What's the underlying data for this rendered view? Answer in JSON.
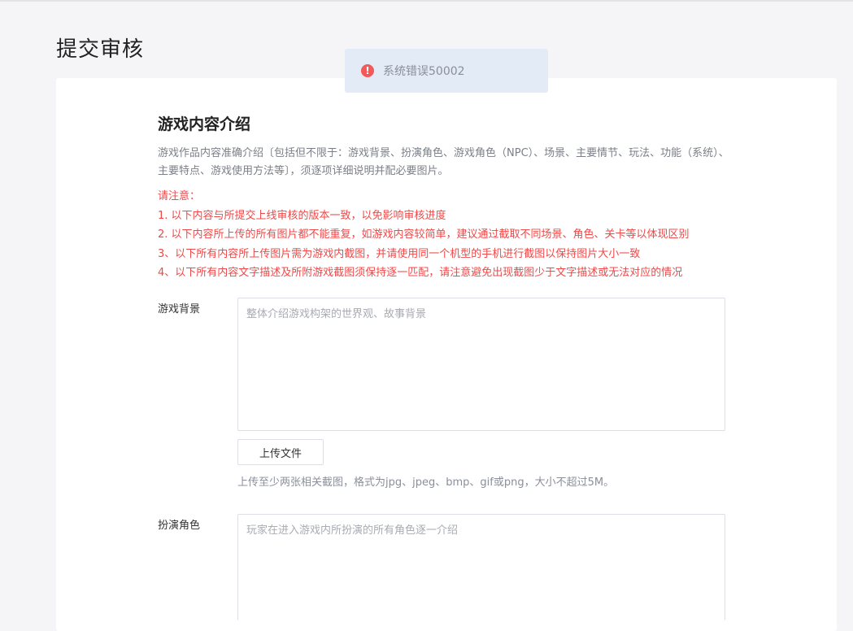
{
  "page": {
    "title": "提交审核"
  },
  "toast": {
    "icon": "error-icon",
    "message": "系统错误50002"
  },
  "intro": {
    "title": "游戏内容介绍",
    "description": "游戏作品内容准确介绍〔包括但不限于：游戏背景、扮演角色、游戏角色（NPC）、场景、主要情节、玩法、功能（系统）、主要特点、游戏使用方法等〕，须逐项详细说明并配必要图片。",
    "notice_title": "请注意：",
    "notices": [
      "1. 以下内容与所提交上线审核的版本一致，以免影响审核进度",
      "2. 以下内容所上传的所有图片都不能重复，如游戏内容较简单，建议通过截取不同场景、角色、关卡等以体现区别",
      "3、以下所有内容所上传图片需为游戏内截图，并请使用同一个机型的手机进行截图以保持图片大小一致",
      "4、以下所有内容文字描述及所附游戏截图须保持逐一匹配，请注意避免出现截图少于文字描述或无法对应的情况"
    ]
  },
  "fields": {
    "background": {
      "label": "游戏背景",
      "placeholder": "整体介绍游戏构架的世界观、故事背景",
      "upload_label": "上传文件",
      "upload_hint": "上传至少两张相关截图，格式为jpg、jpeg、bmp、gif或png，大小不超过5M。"
    },
    "role": {
      "label": "扮演角色",
      "placeholder": "玩家在进入游戏内所扮演的所有角色逐一介绍"
    }
  },
  "colors": {
    "accent_error": "#f04848",
    "toast_bg": "#e3ebf6",
    "page_bg": "#f5f5f7"
  }
}
